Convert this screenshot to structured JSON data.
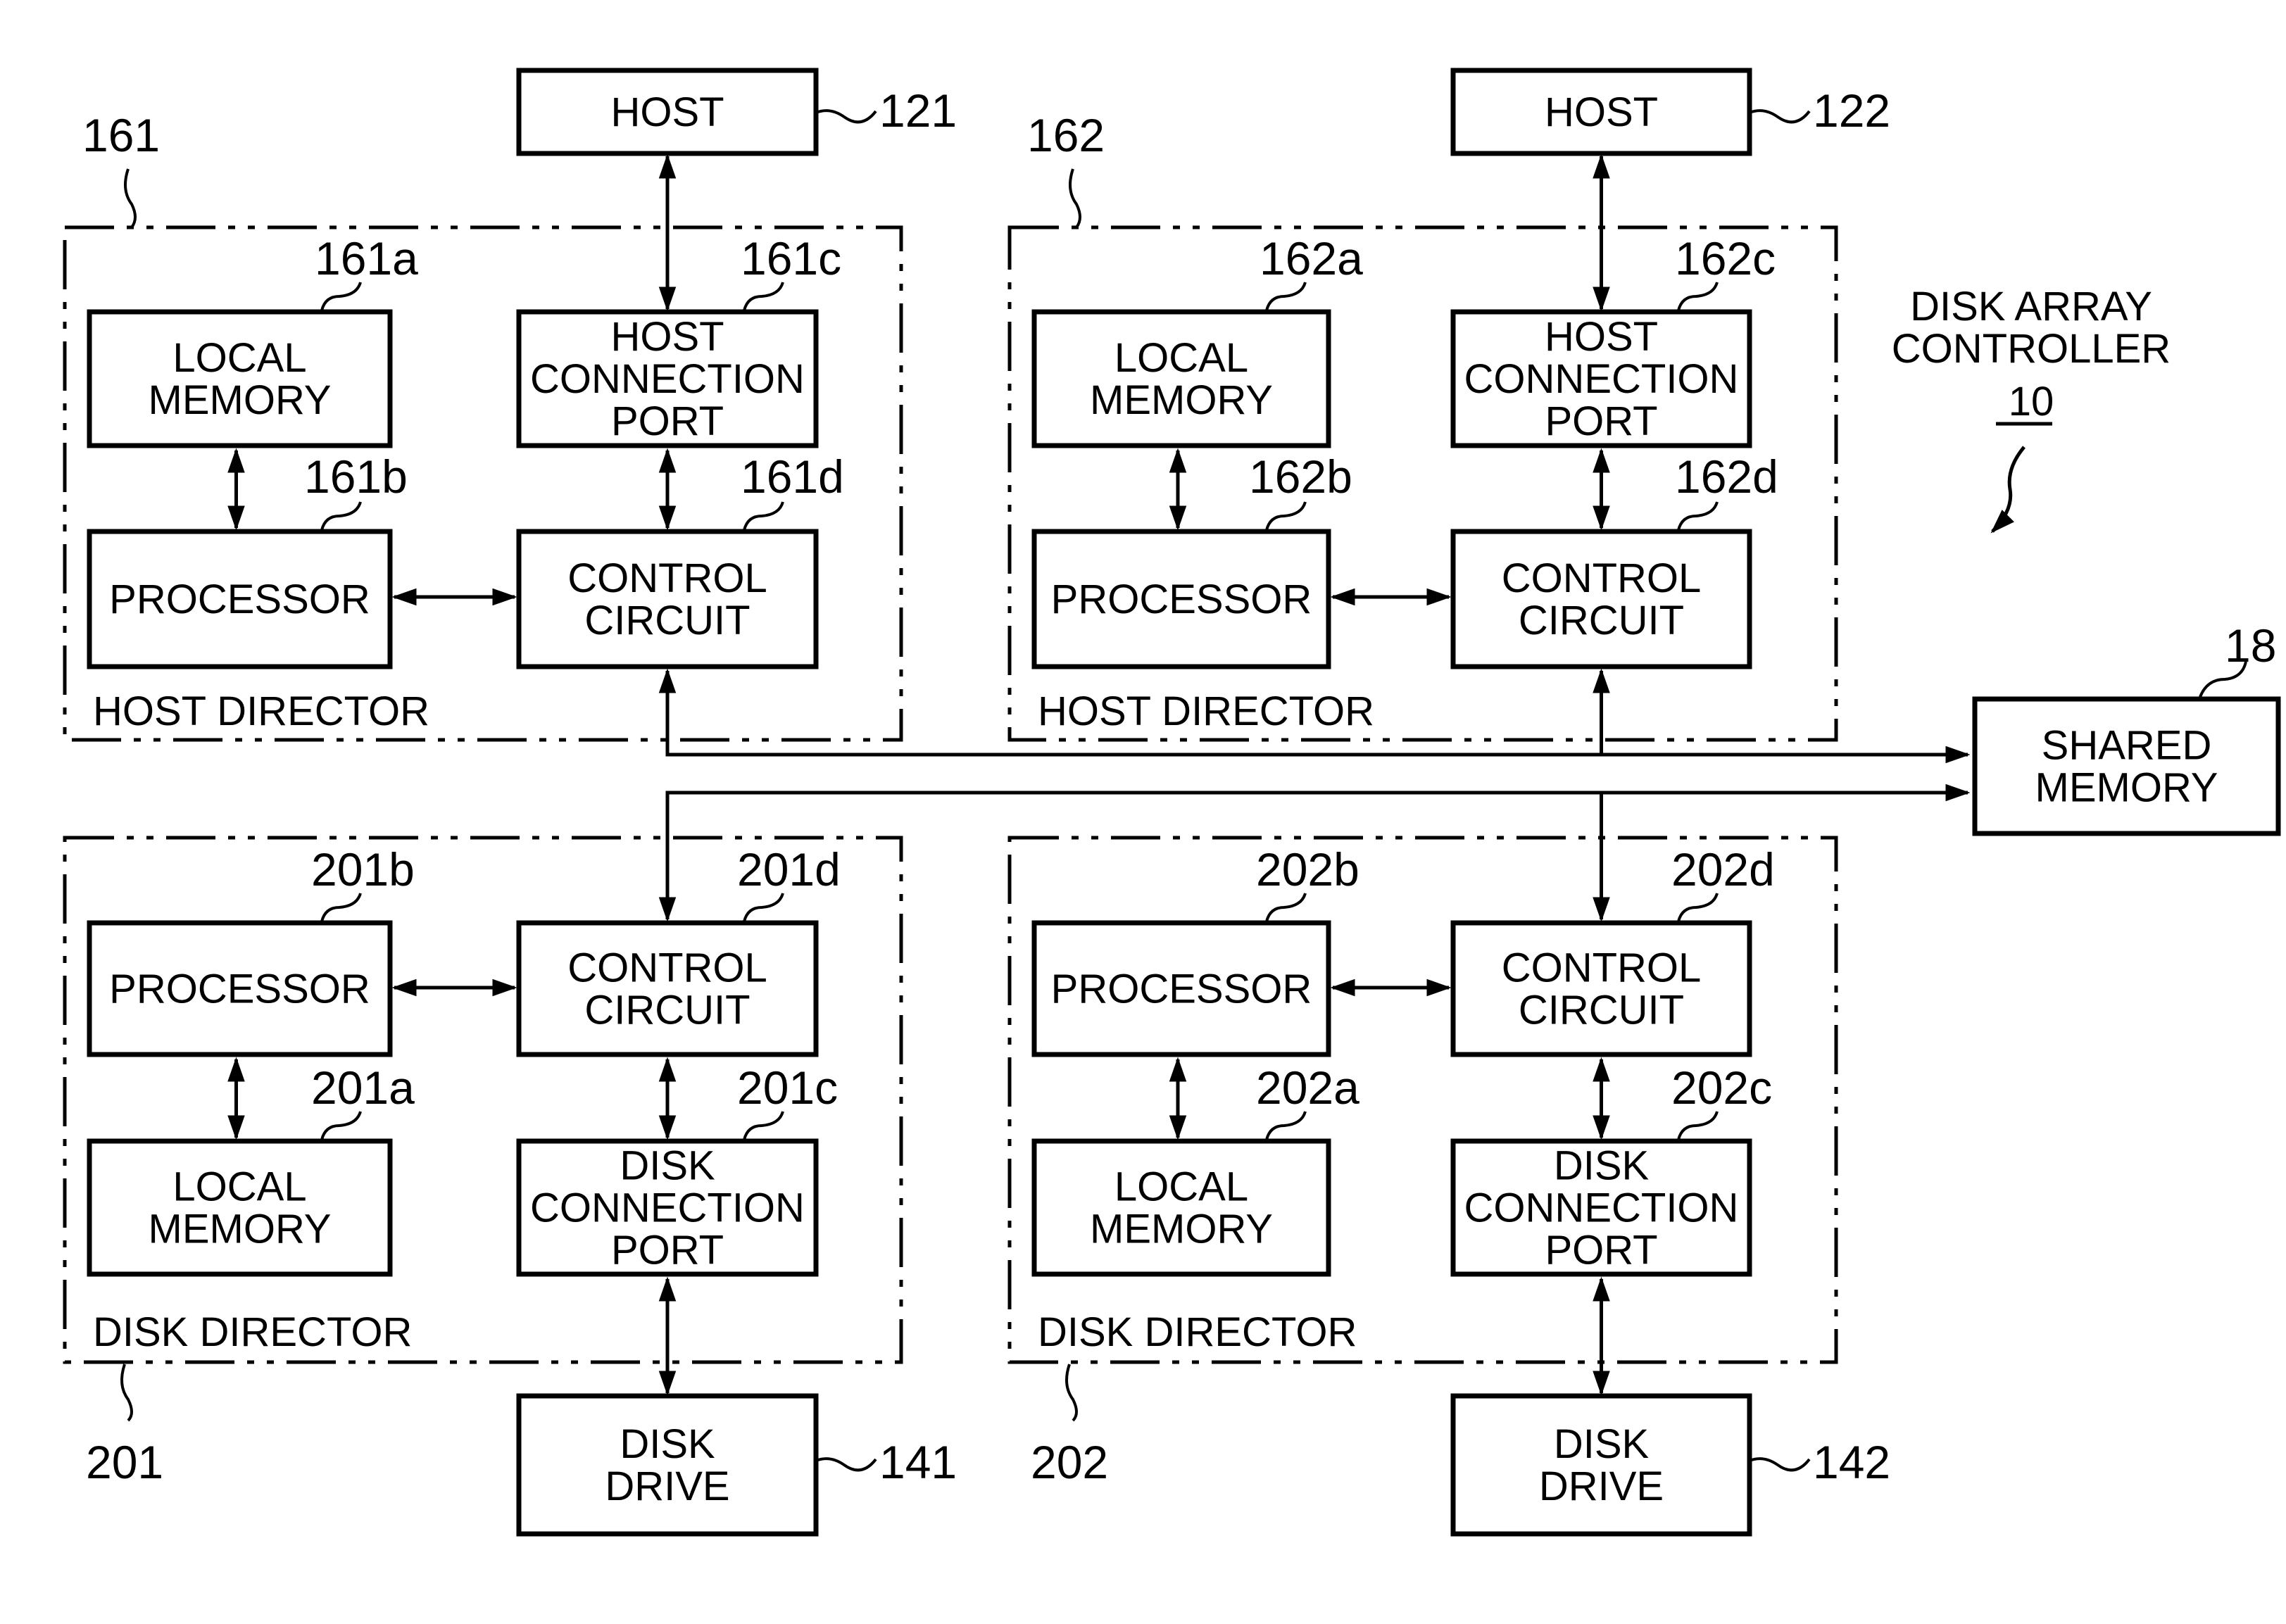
{
  "title": {
    "line1": "DISK ARRAY",
    "line2": "CONTROLLER",
    "ref": "10"
  },
  "hosts": [
    {
      "ref": "121",
      "label": "HOST"
    },
    {
      "ref": "122",
      "label": "HOST"
    }
  ],
  "host_directors": [
    {
      "ref": "161",
      "label": "HOST DIRECTOR",
      "local_memory": {
        "ref": "161a",
        "lines": [
          "LOCAL",
          "MEMORY"
        ]
      },
      "processor": {
        "ref": "161b",
        "lines": [
          "PROCESSOR"
        ]
      },
      "port": {
        "ref": "161c",
        "lines": [
          "HOST",
          "CONNECTION",
          "PORT"
        ]
      },
      "control": {
        "ref": "161d",
        "lines": [
          "CONTROL",
          "CIRCUIT"
        ]
      }
    },
    {
      "ref": "162",
      "label": "HOST DIRECTOR",
      "local_memory": {
        "ref": "162a",
        "lines": [
          "LOCAL",
          "MEMORY"
        ]
      },
      "processor": {
        "ref": "162b",
        "lines": [
          "PROCESSOR"
        ]
      },
      "port": {
        "ref": "162c",
        "lines": [
          "HOST",
          "CONNECTION",
          "PORT"
        ]
      },
      "control": {
        "ref": "162d",
        "lines": [
          "CONTROL",
          "CIRCUIT"
        ]
      }
    }
  ],
  "disk_directors": [
    {
      "ref": "201",
      "label": "DISK DIRECTOR",
      "local_memory": {
        "ref": "201a",
        "lines": [
          "LOCAL",
          "MEMORY"
        ]
      },
      "processor": {
        "ref": "201b",
        "lines": [
          "PROCESSOR"
        ]
      },
      "port": {
        "ref": "201c",
        "lines": [
          "DISK",
          "CONNECTION",
          "PORT"
        ]
      },
      "control": {
        "ref": "201d",
        "lines": [
          "CONTROL",
          "CIRCUIT"
        ]
      }
    },
    {
      "ref": "202",
      "label": "DISK DIRECTOR",
      "local_memory": {
        "ref": "202a",
        "lines": [
          "LOCAL",
          "MEMORY"
        ]
      },
      "processor": {
        "ref": "202b",
        "lines": [
          "PROCESSOR"
        ]
      },
      "port": {
        "ref": "202c",
        "lines": [
          "DISK",
          "CONNECTION",
          "PORT"
        ]
      },
      "control": {
        "ref": "202d",
        "lines": [
          "CONTROL",
          "CIRCUIT"
        ]
      }
    }
  ],
  "disk_drives": [
    {
      "ref": "141",
      "lines": [
        "DISK",
        "DRIVE"
      ]
    },
    {
      "ref": "142",
      "lines": [
        "DISK",
        "DRIVE"
      ]
    }
  ],
  "shared_memory": {
    "ref": "18",
    "lines": [
      "SHARED",
      "MEMORY"
    ]
  }
}
